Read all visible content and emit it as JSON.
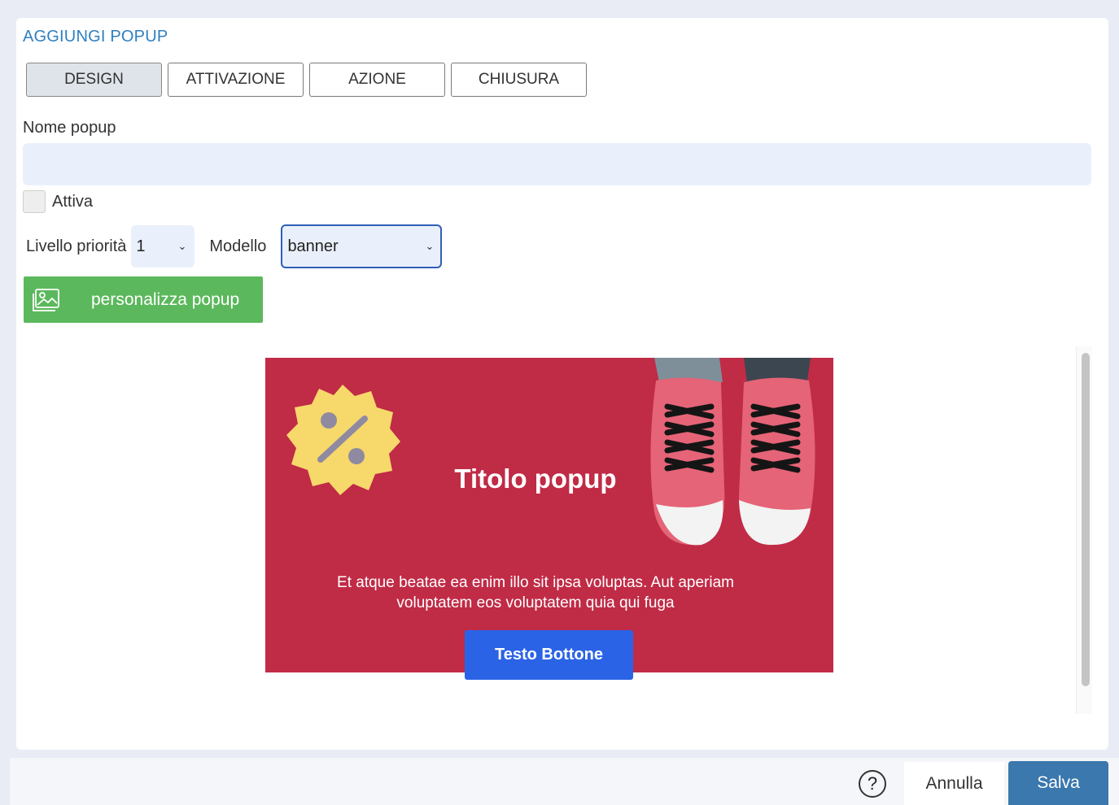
{
  "dialog": {
    "title": "AGGIUNGI POPUP",
    "tabs": [
      {
        "label": "DESIGN",
        "active": true
      },
      {
        "label": "ATTIVAZIONE",
        "active": false
      },
      {
        "label": "AZIONE",
        "active": false
      },
      {
        "label": "CHIUSURA",
        "active": false
      }
    ]
  },
  "form": {
    "name_label": "Nome popup",
    "name_value": "",
    "active_label": "Attiva",
    "active_checked": false,
    "priority_label": "Livello priorità",
    "priority_value": "1",
    "model_label": "Modello",
    "model_value": "banner",
    "customize_label": "personalizza popup",
    "customize_icon": "image-icon"
  },
  "preview": {
    "title": "Titolo popup",
    "text": "Et atque beatae ea enim illo sit ipsa voluptas. Aut aperiam voluptatem eos voluptatem quia qui fuga",
    "button_label": "Testo Bottone",
    "background_color": "#c02b46",
    "button_color": "#2b63e6",
    "badge_icon": "discount-percent-badge",
    "image": "pink-sneakers-photo"
  },
  "footer": {
    "help_label": "?",
    "cancel_label": "Annulla",
    "save_label": "Salva"
  },
  "colors": {
    "accent": "#2f7fc1",
    "success": "#5cb85c",
    "primary": "#3a78ad"
  }
}
